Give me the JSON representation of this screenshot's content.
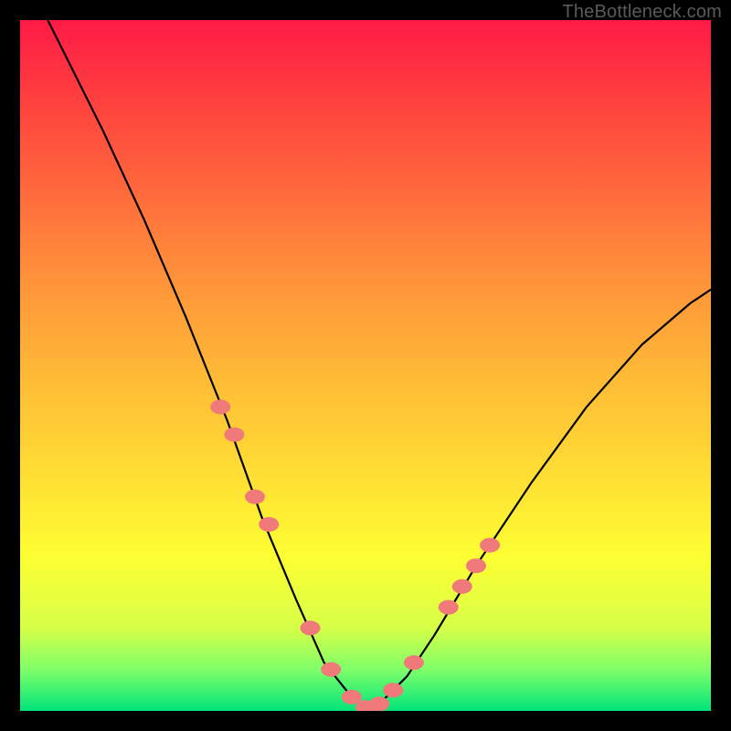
{
  "watermark": "TheBottleneck.com",
  "chart_data": {
    "type": "line",
    "title": "",
    "xlabel": "",
    "ylabel": "",
    "xlim": [
      0,
      100
    ],
    "ylim": [
      0,
      100
    ],
    "series": [
      {
        "name": "bottleneck-curve",
        "x": [
          0,
          6,
          12,
          18,
          24,
          30,
          35,
          40,
          44,
          48,
          50,
          52,
          56,
          60,
          66,
          74,
          82,
          90,
          97,
          100
        ],
        "values": [
          108,
          96,
          84,
          71,
          57,
          42,
          28,
          16,
          7,
          2,
          0.5,
          1,
          5,
          11,
          21,
          33,
          44,
          53,
          59,
          61
        ]
      }
    ],
    "highlight_points": {
      "name": "pink-dots",
      "color": "#f07a7a",
      "x": [
        29,
        31,
        34,
        36,
        42,
        45,
        48,
        50,
        52,
        54,
        57,
        62,
        64,
        66,
        68
      ],
      "values": [
        44,
        40,
        31,
        27,
        12,
        6,
        2,
        0.5,
        1,
        3,
        7,
        15,
        18,
        21,
        24
      ]
    }
  }
}
